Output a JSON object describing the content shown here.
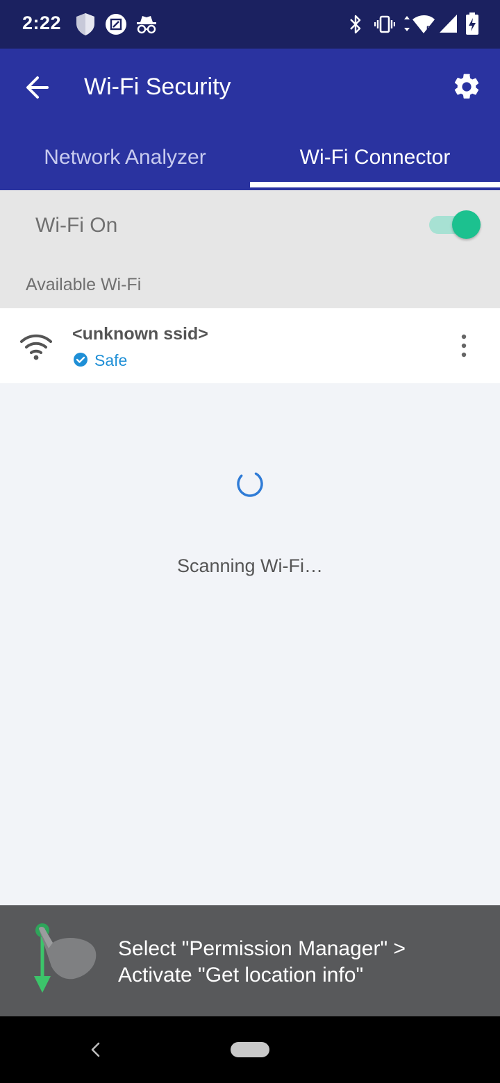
{
  "status_bar": {
    "time": "2:22",
    "icons": [
      "shield-icon",
      "screenshot-icon",
      "incognito-icon",
      "bluetooth-icon",
      "vibrate-icon",
      "wifi-signal-icon",
      "cell-signal-icon",
      "battery-charging-icon"
    ]
  },
  "app_bar": {
    "title": "Wi-Fi Security",
    "back_icon": "arrow-back-icon",
    "settings_icon": "gear-icon",
    "background": "#2a33a0"
  },
  "tabs": [
    {
      "label": "Network Analyzer",
      "selected": false
    },
    {
      "label": "Wi-Fi Connector",
      "selected": true
    }
  ],
  "wifi_toggle": {
    "label": "Wi-Fi On",
    "state": "on",
    "accent": "#1cc18f"
  },
  "available": {
    "section_label": "Available Wi-Fi",
    "networks": [
      {
        "ssid": "<unknown ssid>",
        "status": "Safe",
        "status_color": "#1f8fd6",
        "icon": "wifi-icon",
        "menu_icon": "more-vert-icon"
      }
    ]
  },
  "scanning": {
    "text": "Scanning Wi-Fi…",
    "spinner_color": "#2f7bd6"
  },
  "banner": {
    "line1": "Select \"Permission Manager\" >",
    "line2": "Activate \"Get location info\"",
    "icon": "swipe-down-hand-icon"
  },
  "nav_bar": {
    "back_icon": "nav-back-icon",
    "home_icon": "home-pill-icon"
  }
}
